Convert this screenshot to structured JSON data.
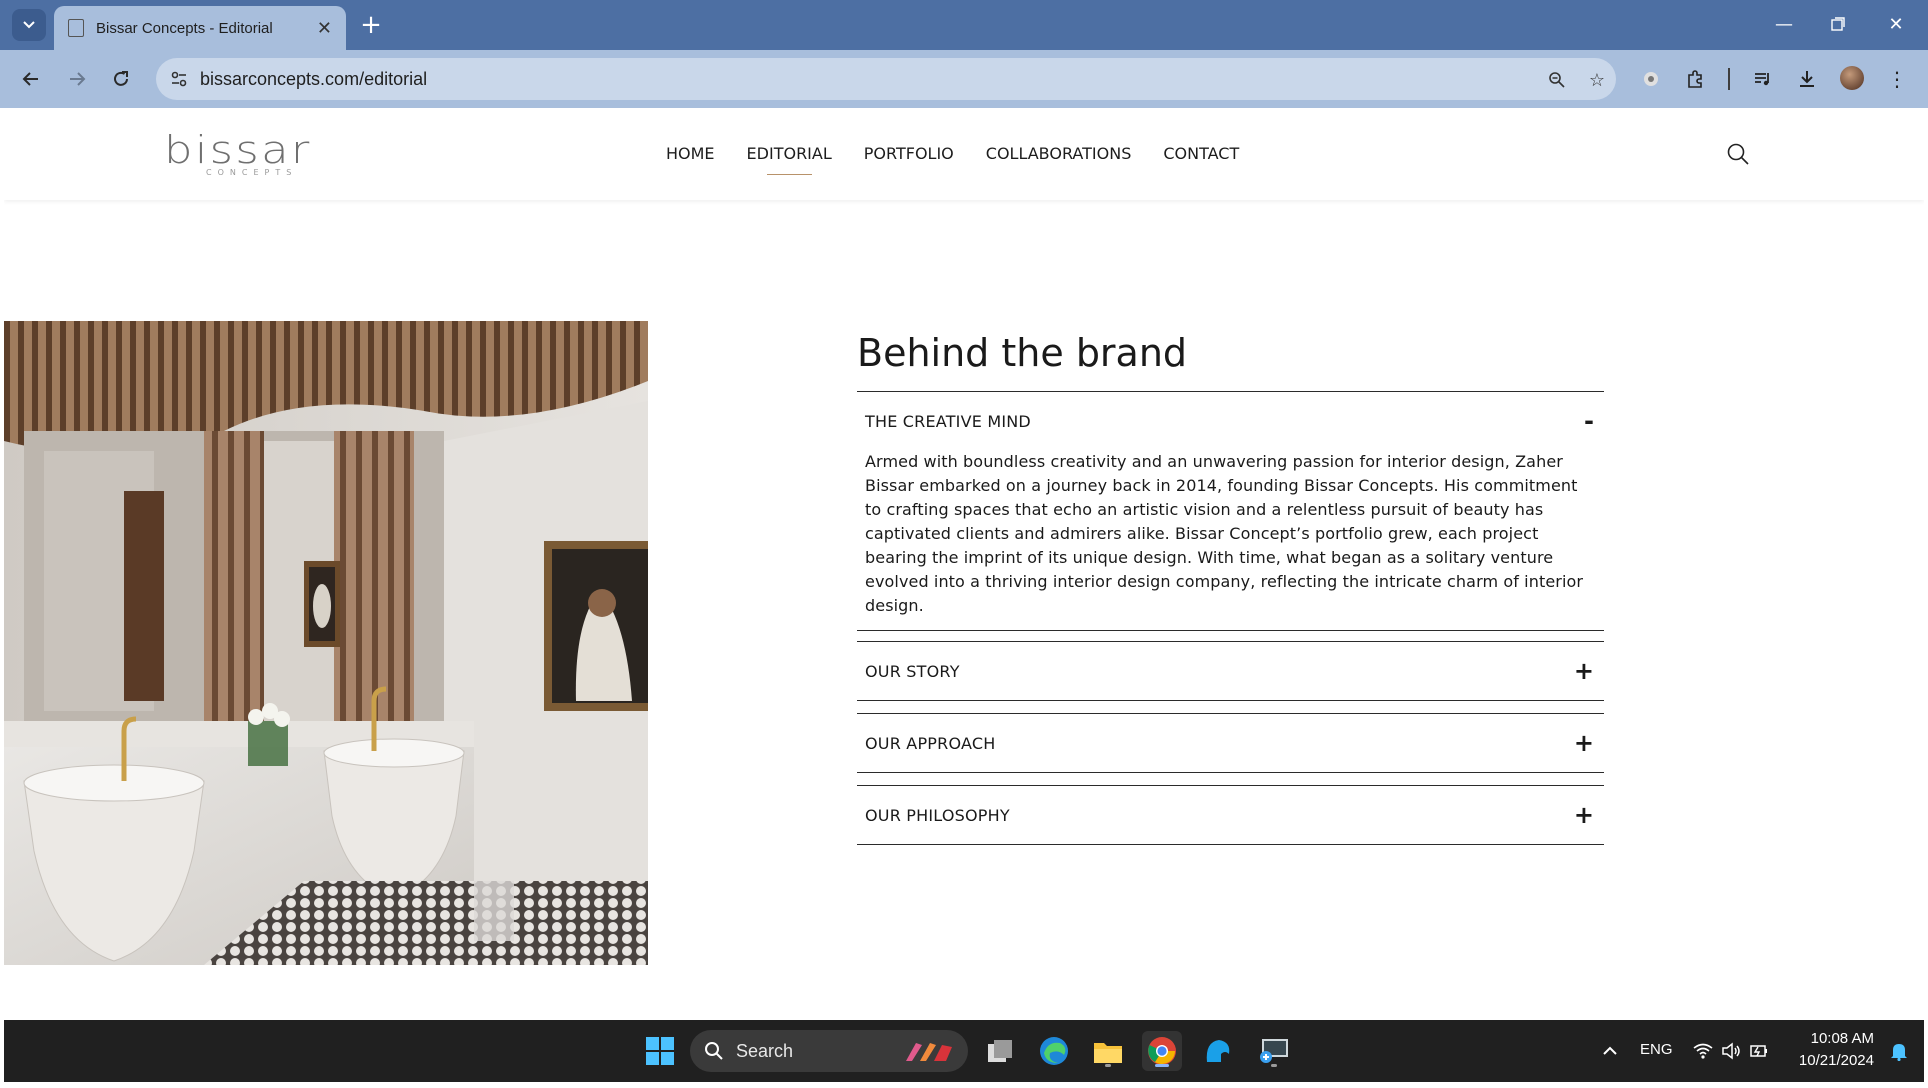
{
  "browser": {
    "tab_title": "Bissar Concepts - Editorial",
    "url": "bissarconcepts.com/editorial"
  },
  "site": {
    "logo_text": "bissar",
    "logo_subtext": "CONCEPTS",
    "nav": [
      "HOME",
      "EDITORIAL",
      "PORTFOLIO",
      "COLLABORATIONS",
      "CONTACT"
    ],
    "active_nav": "EDITORIAL",
    "accent_color": "#b8926a"
  },
  "main": {
    "heading": "Behind the brand",
    "accordion": [
      {
        "title": "THE CREATIVE MIND",
        "expanded": true,
        "sign": "-",
        "body": "Armed with boundless creativity and an unwavering passion for interior design, Zaher Bissar embarked on a journey back in 2014, founding Bissar Concepts. His commitment to crafting spaces that echo an artistic vision and a relentless pursuit of beauty has captivated clients and admirers alike. Bissar Concept’s portfolio grew, each project bearing the imprint of its unique design. With time, what began as a solitary venture evolved into a thriving interior design company, reflecting the intricate charm of interior design."
      },
      {
        "title": "OUR STORY",
        "expanded": false,
        "sign": "+"
      },
      {
        "title": "OUR APPROACH",
        "expanded": false,
        "sign": "+"
      },
      {
        "title": "OUR PHILOSOPHY",
        "expanded": false,
        "sign": "+"
      }
    ]
  },
  "taskbar": {
    "search_label": "Search",
    "language": "ENG",
    "time": "10:08 AM",
    "date": "10/21/2024"
  }
}
